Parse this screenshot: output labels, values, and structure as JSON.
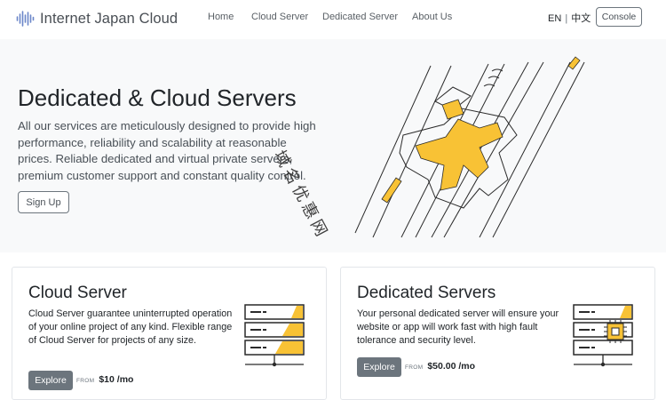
{
  "nav": {
    "brand": "Internet Japan Cloud",
    "links": [
      "Home",
      "Cloud Server",
      "Dedicated Server",
      "About Us"
    ],
    "lang_en": "EN",
    "lang_separator": "|",
    "lang_zh": "中文",
    "console_label": "Console"
  },
  "hero": {
    "title": "Dedicated & Cloud Servers",
    "text": "All our services are meticulously designed to provide high performance, reliability and scalability at reasonable prices. Reliable dedicated and virtual private servers, premium customer support and constant quality control.",
    "signup_label": "Sign Up",
    "watermark": "域名优惠网"
  },
  "cards": [
    {
      "title": "Cloud Server",
      "text": "Cloud Server guarantee uninterrupted operation of your online project of any kind. Flexible range of Cloud Server for projects of any size.",
      "button": "Explore",
      "from": "FROM",
      "price": "$10 /mo"
    },
    {
      "title": "Dedicated Servers",
      "text": "Your personal dedicated server will ensure your website or app will work fast with high fault tolerance and security level.",
      "button": "Explore",
      "from": "FROM",
      "price": "$50.00 /mo"
    }
  ],
  "colors": {
    "accent": "#f8c235",
    "button": "#6c757d",
    "hero_bg": "#f8f9fa"
  },
  "icons": [
    "sound-wave-logo-icon",
    "isometric-server-illustration",
    "server-rack-icon",
    "server-chip-icon"
  ]
}
